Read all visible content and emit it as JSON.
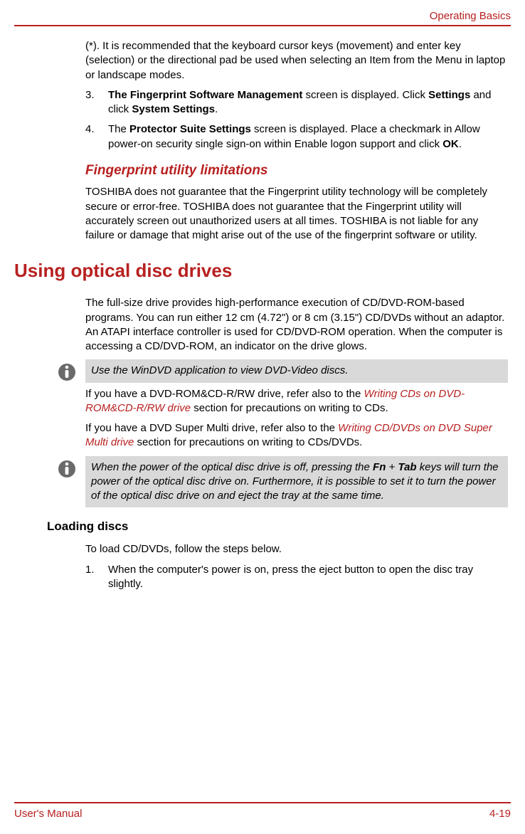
{
  "header": {
    "section": "Operating Basics"
  },
  "body": {
    "p1": "(*). It is recommended that the keyboard cursor keys (movement) and enter key (selection) or the directional pad be used when selecting an Item from the Menu in laptop or landscape modes.",
    "list1": {
      "num3": "3.",
      "item3a": "The Fingerprint Software Management",
      "item3b": " screen is displayed. Click ",
      "item3c": "Settings",
      "item3d": " and click ",
      "item3e": "System Settings",
      "item3f": ".",
      "num4": "4.",
      "item4a": "The ",
      "item4b": "Protector Suite Settings",
      "item4c": " screen is displayed. Place a checkmark in Allow power-on security single sign-on within Enable logon support and click ",
      "item4d": "OK",
      "item4e": "."
    },
    "h3_fingerprint": "Fingerprint utility limitations",
    "p_fingerprint": "TOSHIBA does not guarantee that the Fingerprint utility technology will be completely secure or error-free. TOSHIBA does not guarantee that the Fingerprint utility will accurately screen out unauthorized users at all times. TOSHIBA is not liable for any failure or damage that might arise out of the use of the fingerprint software or utility.",
    "h1_optical": "Using optical disc drives",
    "p_optical": "The full-size drive provides high-performance execution of CD/DVD-ROM-based programs. You can run either 12 cm (4.72\") or 8 cm (3.15\") CD/DVDs without an adaptor. An ATAPI interface controller is used for CD/DVD-ROM operation. When the computer is accessing a CD/DVD-ROM, an indicator on the drive glows.",
    "note1": "Use the WinDVD application to view DVD-Video discs.",
    "p_dvd1a": "If you have a DVD-ROM&CD-R/RW drive, refer also to the ",
    "p_dvd1_link": "Writing CDs on DVD-ROM&CD-R/RW drive",
    "p_dvd1b": " section for precautions on writing to CDs.",
    "p_dvd2a": "If you have a DVD Super Multi drive, refer also to the ",
    "p_dvd2_link": "Writing CD/DVDs on DVD Super Multi drive",
    "p_dvd2b": " section for precautions on writing to CDs/DVDs.",
    "note2a": "When the power of the optical disc drive is off, pressing the ",
    "note2b": "Fn",
    "note2c": " + ",
    "note2d": "Tab",
    "note2e": " keys will turn the power of the optical disc drive on. Furthermore, it is possible to set it to turn the power of the optical disc drive on and eject the tray at the same time.",
    "h2_loading": "Loading discs",
    "p_loading": "To load CD/DVDs, follow the steps below.",
    "list2": {
      "num1": "1.",
      "item1": "When the computer's power is on, press the eject button to open the disc tray slightly."
    }
  },
  "footer": {
    "left": "User's Manual",
    "right": "4-19"
  }
}
